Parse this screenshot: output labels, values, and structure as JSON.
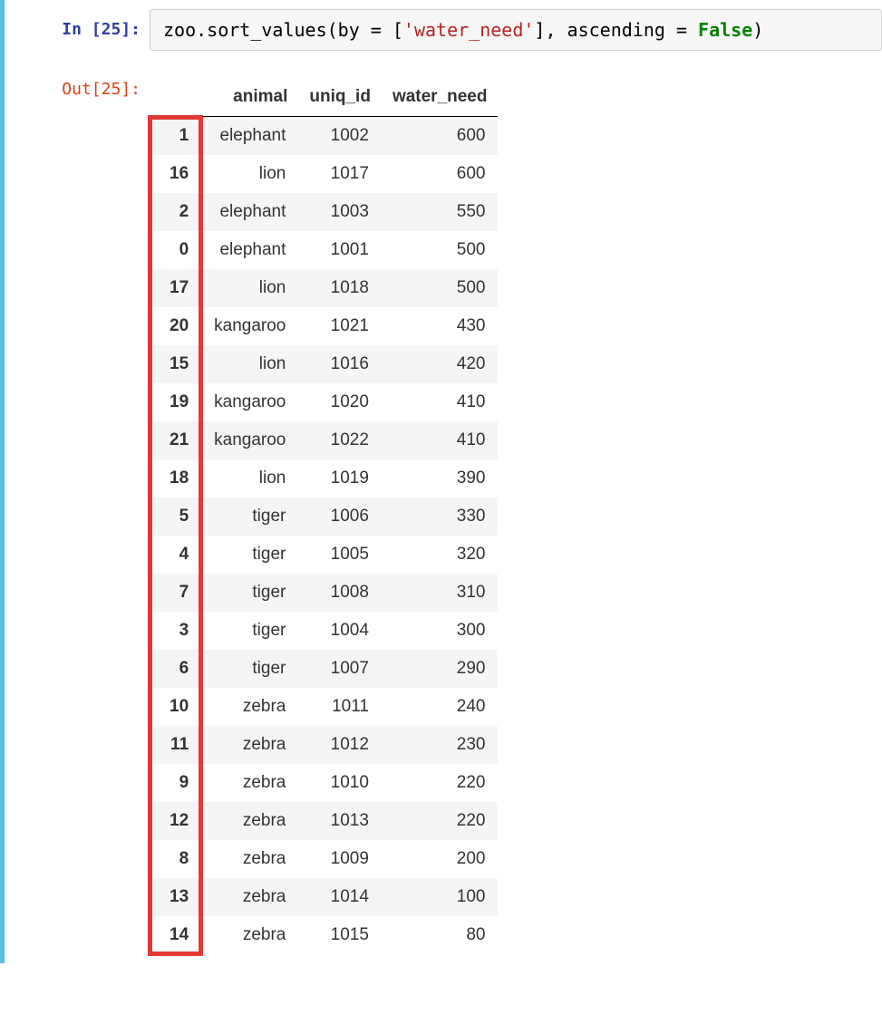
{
  "cell": {
    "in_label": "In [25]:",
    "out_label": "Out[25]:",
    "code_prefix": "zoo.sort_values(by = [",
    "code_str": "'water_need'",
    "code_mid": "], ascending = ",
    "code_kw": "False",
    "code_suffix": ")"
  },
  "table": {
    "headers": [
      "animal",
      "uniq_id",
      "water_need"
    ],
    "rows": [
      {
        "idx": "1",
        "animal": "elephant",
        "uniq_id": "1002",
        "water_need": "600"
      },
      {
        "idx": "16",
        "animal": "lion",
        "uniq_id": "1017",
        "water_need": "600"
      },
      {
        "idx": "2",
        "animal": "elephant",
        "uniq_id": "1003",
        "water_need": "550"
      },
      {
        "idx": "0",
        "animal": "elephant",
        "uniq_id": "1001",
        "water_need": "500"
      },
      {
        "idx": "17",
        "animal": "lion",
        "uniq_id": "1018",
        "water_need": "500"
      },
      {
        "idx": "20",
        "animal": "kangaroo",
        "uniq_id": "1021",
        "water_need": "430"
      },
      {
        "idx": "15",
        "animal": "lion",
        "uniq_id": "1016",
        "water_need": "420"
      },
      {
        "idx": "19",
        "animal": "kangaroo",
        "uniq_id": "1020",
        "water_need": "410"
      },
      {
        "idx": "21",
        "animal": "kangaroo",
        "uniq_id": "1022",
        "water_need": "410"
      },
      {
        "idx": "18",
        "animal": "lion",
        "uniq_id": "1019",
        "water_need": "390"
      },
      {
        "idx": "5",
        "animal": "tiger",
        "uniq_id": "1006",
        "water_need": "330"
      },
      {
        "idx": "4",
        "animal": "tiger",
        "uniq_id": "1005",
        "water_need": "320"
      },
      {
        "idx": "7",
        "animal": "tiger",
        "uniq_id": "1008",
        "water_need": "310"
      },
      {
        "idx": "3",
        "animal": "tiger",
        "uniq_id": "1004",
        "water_need": "300"
      },
      {
        "idx": "6",
        "animal": "tiger",
        "uniq_id": "1007",
        "water_need": "290"
      },
      {
        "idx": "10",
        "animal": "zebra",
        "uniq_id": "1011",
        "water_need": "240"
      },
      {
        "idx": "11",
        "animal": "zebra",
        "uniq_id": "1012",
        "water_need": "230"
      },
      {
        "idx": "9",
        "animal": "zebra",
        "uniq_id": "1010",
        "water_need": "220"
      },
      {
        "idx": "12",
        "animal": "zebra",
        "uniq_id": "1013",
        "water_need": "220"
      },
      {
        "idx": "8",
        "animal": "zebra",
        "uniq_id": "1009",
        "water_need": "200"
      },
      {
        "idx": "13",
        "animal": "zebra",
        "uniq_id": "1014",
        "water_need": "100"
      },
      {
        "idx": "14",
        "animal": "zebra",
        "uniq_id": "1015",
        "water_need": "80"
      }
    ]
  },
  "annotation": {
    "highlight": "index-column"
  }
}
